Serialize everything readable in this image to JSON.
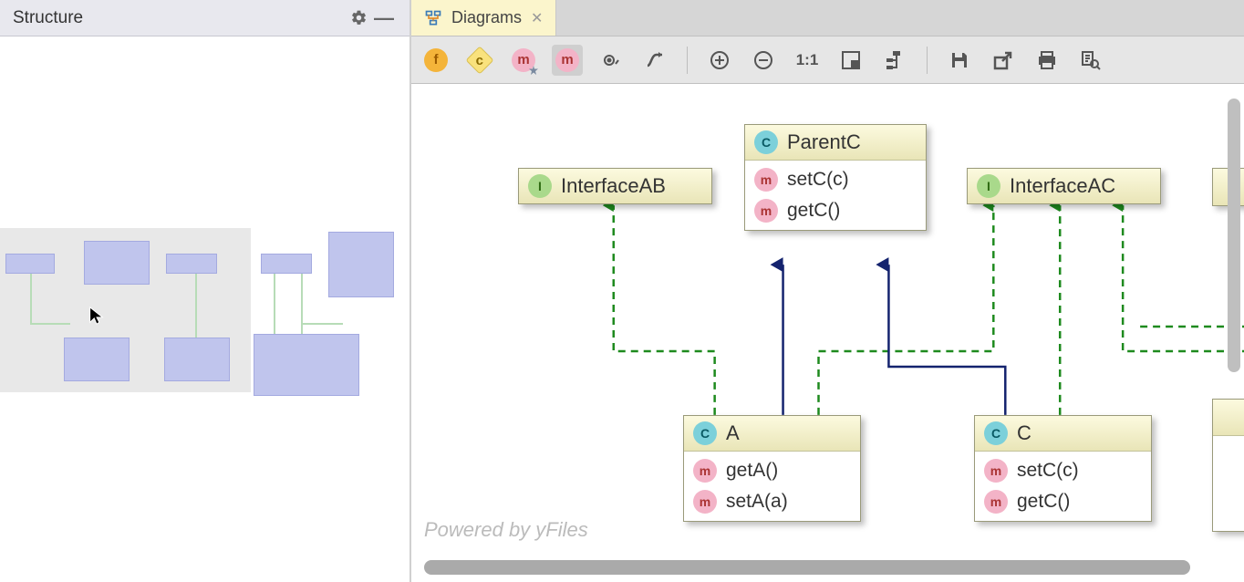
{
  "sidePanel": {
    "title": "Structure"
  },
  "tab": {
    "label": "Diagrams"
  },
  "toolbar": {
    "glyphs": {
      "f": "f",
      "c": "c",
      "m1": "m",
      "m2": "m",
      "ratio": "1:1"
    }
  },
  "nodes": {
    "interfaceAB": {
      "name": "InterfaceAB"
    },
    "parentC": {
      "name": "ParentC",
      "m1": "setC(c)",
      "m2": "getC()"
    },
    "interfaceAC": {
      "name": "InterfaceAC"
    },
    "classA": {
      "name": "A",
      "m1": "getA()",
      "m2": "setA(a)"
    },
    "classC": {
      "name": "C",
      "m1": "setC(c)",
      "m2": "getC()"
    }
  },
  "footer": "Powered by yFiles"
}
